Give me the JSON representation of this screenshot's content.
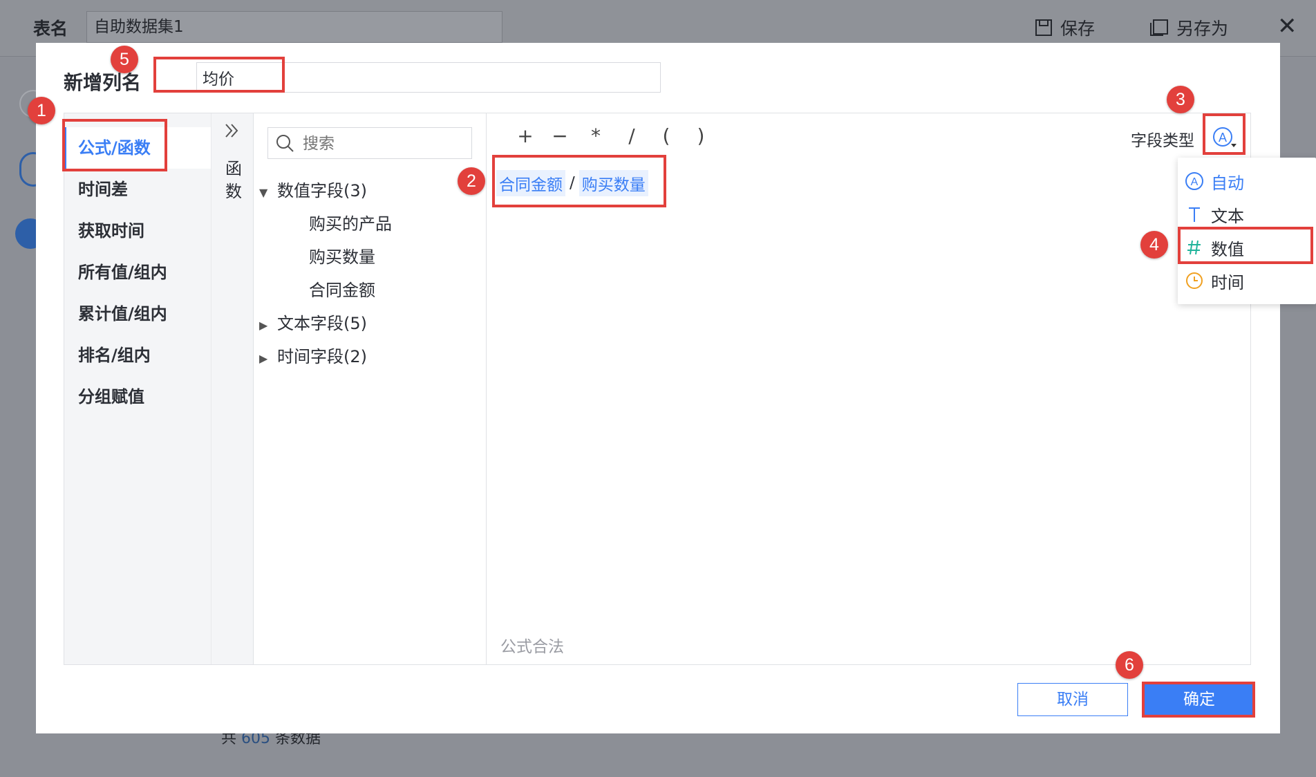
{
  "background": {
    "table_label": "表名",
    "dataset_name": "自助数据集1",
    "save_label": "保存",
    "save_as_label": "另存为",
    "footer_prefix": "共",
    "footer_count": "605",
    "footer_suffix": "条数据"
  },
  "dialog": {
    "title": "新增列名",
    "column_name": "均价",
    "categories": [
      "公式/函数",
      "时间差",
      "获取时间",
      "所有值/组内",
      "累计值/组内",
      "排名/组内",
      "分组赋值"
    ],
    "function_panel_label": "函数",
    "search_placeholder": "搜索",
    "field_groups": [
      {
        "label": "数值字段(3)",
        "expanded": true,
        "children": [
          "购买的产品",
          "购买数量",
          "合同金额"
        ]
      },
      {
        "label": "文本字段(5)",
        "expanded": false,
        "children": []
      },
      {
        "label": "时间字段(2)",
        "expanded": false,
        "children": []
      }
    ],
    "operators": [
      "+",
      "−",
      "*",
      "/",
      "(",
      ")"
    ],
    "field_type_label": "字段类型",
    "formula": {
      "field_a": "合同金额",
      "operator": "/",
      "field_b": "购买数量"
    },
    "validation": "公式合法",
    "field_type_options": [
      {
        "label": "自动",
        "icon": "auto-icon"
      },
      {
        "label": "文本",
        "icon": "text-type-icon"
      },
      {
        "label": "数值",
        "icon": "number-type-icon"
      },
      {
        "label": "时间",
        "icon": "clock-icon"
      }
    ],
    "cancel_label": "取消",
    "ok_label": "确定"
  },
  "annotations": [
    "1",
    "2",
    "3",
    "4",
    "5",
    "6"
  ],
  "colors": {
    "accent": "#3a7ef5",
    "annotation": "#e2403c",
    "sidebar_bg": "#f4f5f7"
  }
}
